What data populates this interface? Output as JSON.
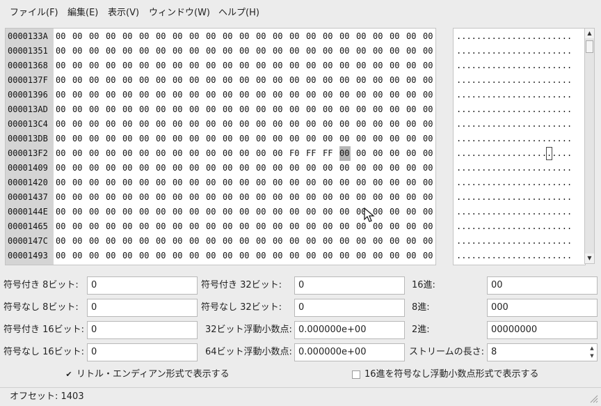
{
  "menu": [
    {
      "label": "ファイル(F)"
    },
    {
      "label": "編集(E)"
    },
    {
      "label": "表示(V)"
    },
    {
      "label": "ウィンドウ(W)"
    },
    {
      "label": "ヘルプ(H)"
    }
  ],
  "hex_view": {
    "rows": [
      {
        "address": "0000133A",
        "bytes": [
          "00",
          "00",
          "00",
          "00",
          "00",
          "00",
          "00",
          "00",
          "00",
          "00",
          "00",
          "00",
          "00",
          "00",
          "00",
          "00",
          "00",
          "00",
          "00",
          "00",
          "00",
          "00",
          "00"
        ],
        "ascii": "......................."
      },
      {
        "address": "00001351",
        "bytes": [
          "00",
          "00",
          "00",
          "00",
          "00",
          "00",
          "00",
          "00",
          "00",
          "00",
          "00",
          "00",
          "00",
          "00",
          "00",
          "00",
          "00",
          "00",
          "00",
          "00",
          "00",
          "00",
          "00"
        ],
        "ascii": "......................."
      },
      {
        "address": "00001368",
        "bytes": [
          "00",
          "00",
          "00",
          "00",
          "00",
          "00",
          "00",
          "00",
          "00",
          "00",
          "00",
          "00",
          "00",
          "00",
          "00",
          "00",
          "00",
          "00",
          "00",
          "00",
          "00",
          "00",
          "00"
        ],
        "ascii": "......................."
      },
      {
        "address": "0000137F",
        "bytes": [
          "00",
          "00",
          "00",
          "00",
          "00",
          "00",
          "00",
          "00",
          "00",
          "00",
          "00",
          "00",
          "00",
          "00",
          "00",
          "00",
          "00",
          "00",
          "00",
          "00",
          "00",
          "00",
          "00"
        ],
        "ascii": "......................."
      },
      {
        "address": "00001396",
        "bytes": [
          "00",
          "00",
          "00",
          "00",
          "00",
          "00",
          "00",
          "00",
          "00",
          "00",
          "00",
          "00",
          "00",
          "00",
          "00",
          "00",
          "00",
          "00",
          "00",
          "00",
          "00",
          "00",
          "00"
        ],
        "ascii": "......................."
      },
      {
        "address": "000013AD",
        "bytes": [
          "00",
          "00",
          "00",
          "00",
          "00",
          "00",
          "00",
          "00",
          "00",
          "00",
          "00",
          "00",
          "00",
          "00",
          "00",
          "00",
          "00",
          "00",
          "00",
          "00",
          "00",
          "00",
          "00"
        ],
        "ascii": "......................."
      },
      {
        "address": "000013C4",
        "bytes": [
          "00",
          "00",
          "00",
          "00",
          "00",
          "00",
          "00",
          "00",
          "00",
          "00",
          "00",
          "00",
          "00",
          "00",
          "00",
          "00",
          "00",
          "00",
          "00",
          "00",
          "00",
          "00",
          "00"
        ],
        "ascii": "......................."
      },
      {
        "address": "000013DB",
        "bytes": [
          "00",
          "00",
          "00",
          "00",
          "00",
          "00",
          "00",
          "00",
          "00",
          "00",
          "00",
          "00",
          "00",
          "00",
          "00",
          "00",
          "00",
          "00",
          "00",
          "00",
          "00",
          "00",
          "00"
        ],
        "ascii": "......................."
      },
      {
        "address": "000013F2",
        "bytes": [
          "00",
          "00",
          "00",
          "00",
          "00",
          "00",
          "00",
          "00",
          "00",
          "00",
          "00",
          "00",
          "00",
          "00",
          "F0",
          "FF",
          "FF",
          "00",
          "00",
          "00",
          "00",
          "00",
          "00"
        ],
        "ascii": "......................."
      },
      {
        "address": "00001409",
        "bytes": [
          "00",
          "00",
          "00",
          "00",
          "00",
          "00",
          "00",
          "00",
          "00",
          "00",
          "00",
          "00",
          "00",
          "00",
          "00",
          "00",
          "00",
          "00",
          "00",
          "00",
          "00",
          "00",
          "00"
        ],
        "ascii": "......................."
      },
      {
        "address": "00001420",
        "bytes": [
          "00",
          "00",
          "00",
          "00",
          "00",
          "00",
          "00",
          "00",
          "00",
          "00",
          "00",
          "00",
          "00",
          "00",
          "00",
          "00",
          "00",
          "00",
          "00",
          "00",
          "00",
          "00",
          "00"
        ],
        "ascii": "......................."
      },
      {
        "address": "00001437",
        "bytes": [
          "00",
          "00",
          "00",
          "00",
          "00",
          "00",
          "00",
          "00",
          "00",
          "00",
          "00",
          "00",
          "00",
          "00",
          "00",
          "00",
          "00",
          "00",
          "00",
          "00",
          "00",
          "00",
          "00"
        ],
        "ascii": "......................."
      },
      {
        "address": "0000144E",
        "bytes": [
          "00",
          "00",
          "00",
          "00",
          "00",
          "00",
          "00",
          "00",
          "00",
          "00",
          "00",
          "00",
          "00",
          "00",
          "00",
          "00",
          "00",
          "00",
          "00",
          "00",
          "00",
          "00",
          "00"
        ],
        "ascii": "......................."
      },
      {
        "address": "00001465",
        "bytes": [
          "00",
          "00",
          "00",
          "00",
          "00",
          "00",
          "00",
          "00",
          "00",
          "00",
          "00",
          "00",
          "00",
          "00",
          "00",
          "00",
          "00",
          "00",
          "00",
          "00",
          "00",
          "00",
          "00"
        ],
        "ascii": "......................."
      },
      {
        "address": "0000147C",
        "bytes": [
          "00",
          "00",
          "00",
          "00",
          "00",
          "00",
          "00",
          "00",
          "00",
          "00",
          "00",
          "00",
          "00",
          "00",
          "00",
          "00",
          "00",
          "00",
          "00",
          "00",
          "00",
          "00",
          "00"
        ],
        "ascii": "......................."
      },
      {
        "address": "00001493",
        "bytes": [
          "00",
          "00",
          "00",
          "00",
          "00",
          "00",
          "00",
          "00",
          "00",
          "00",
          "00",
          "00",
          "00",
          "00",
          "00",
          "00",
          "00",
          "00",
          "00",
          "00",
          "00",
          "00",
          "00"
        ],
        "ascii": "......................."
      }
    ],
    "cursor": {
      "row": 8,
      "col": 17
    }
  },
  "fields": {
    "signed_8": {
      "label": "符号付き 8ビット:",
      "value": "0"
    },
    "unsigned_8": {
      "label": "符号なし 8ビット:",
      "value": "0"
    },
    "signed_16": {
      "label": "符号付き 16ビット:",
      "value": "0"
    },
    "unsigned_16": {
      "label": "符号なし 16ビット:",
      "value": "0"
    },
    "signed_32": {
      "label": "符号付き 32ビット:",
      "value": "0"
    },
    "unsigned_32": {
      "label": "符号なし 32ビット:",
      "value": "0"
    },
    "float_32": {
      "label": "32ビット浮動小数点:",
      "value": "0.000000e+00"
    },
    "float_64": {
      "label": "64ビット浮動小数点:",
      "value": "0.000000e+00"
    },
    "hex": {
      "label": "16進:",
      "value": "00"
    },
    "octal": {
      "label": "8進:",
      "value": "000"
    },
    "binary": {
      "label": "2進:",
      "value": "00000000"
    },
    "stream_length": {
      "label": "ストリームの長さ:",
      "value": "8"
    }
  },
  "options": {
    "little_endian": {
      "label": "リトル・エンディアン形式で表示する",
      "checked": true
    },
    "hex_as_unsigned_float": {
      "label": "16進を符号なし浮動小数点形式で表示する",
      "checked": false
    }
  },
  "status": {
    "offset_text": "オフセット: 1403"
  },
  "icons": {
    "check": "✔",
    "scroll_up": "▲",
    "scroll_down": "▼",
    "spin_up": "▲",
    "spin_down": "▼"
  }
}
